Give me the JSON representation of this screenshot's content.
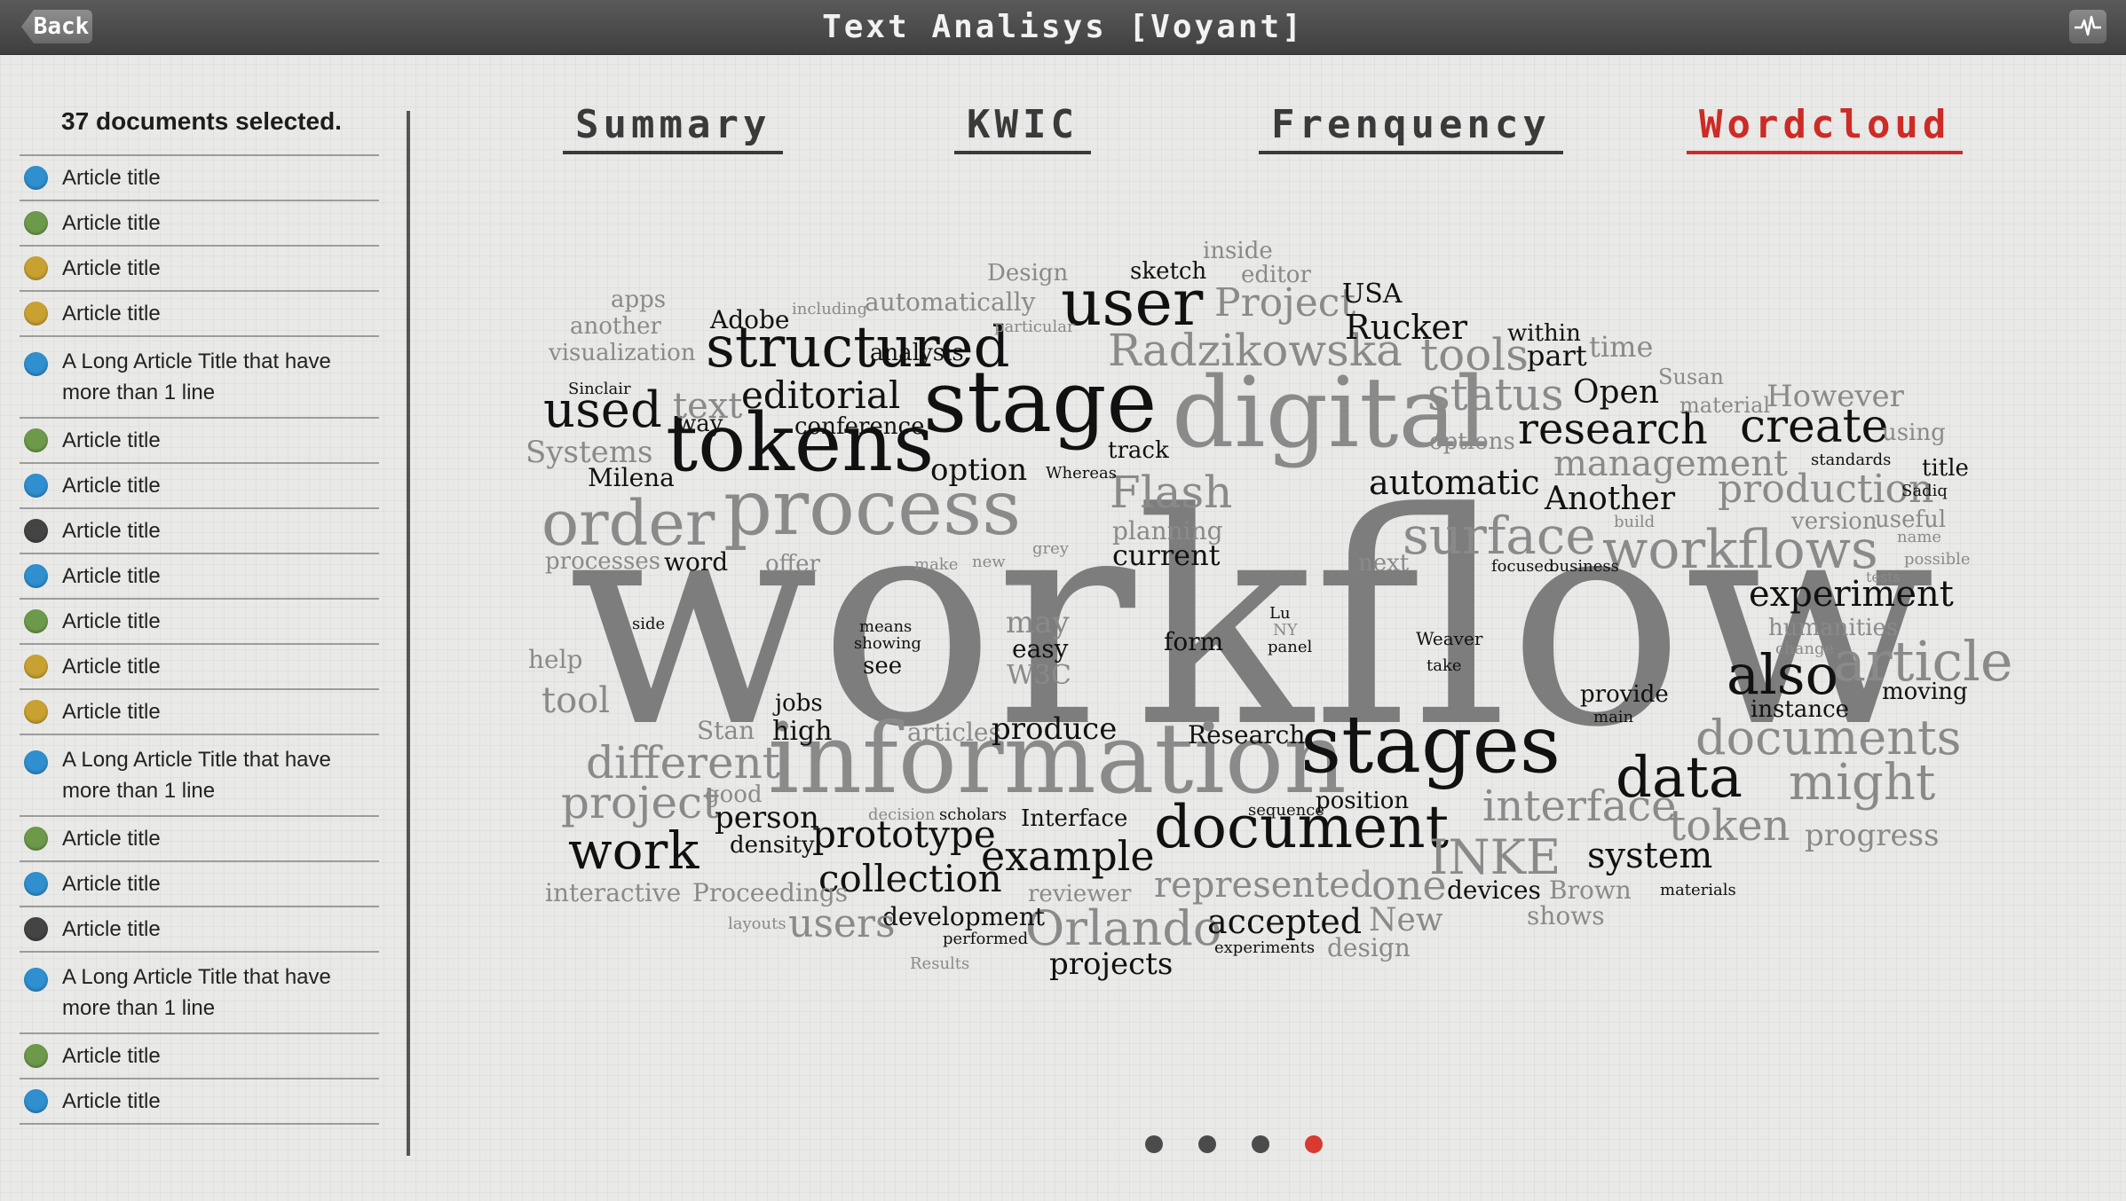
{
  "header": {
    "back_label": "Back",
    "title": "Text Analisys [Voyant]",
    "activity_icon": "pulse-icon"
  },
  "sidebar": {
    "selection_count": "37 documents selected.",
    "documents": [
      {
        "title": "Article title",
        "color": "#2f8fcf"
      },
      {
        "title": "Article title",
        "color": "#6c9a4a"
      },
      {
        "title": "Article title",
        "color": "#c9a131"
      },
      {
        "title": "Article title",
        "color": "#c9a131"
      },
      {
        "title": "A Long Article Title that have\nmore than 1 line",
        "color": "#2f8fcf"
      },
      {
        "title": "Article title",
        "color": "#6c9a4a"
      },
      {
        "title": "Article title",
        "color": "#2f8fcf"
      },
      {
        "title": "Article title",
        "color": "#444444"
      },
      {
        "title": "Article title",
        "color": "#2f8fcf"
      },
      {
        "title": "Article title",
        "color": "#6c9a4a"
      },
      {
        "title": "Article title",
        "color": "#c9a131"
      },
      {
        "title": "Article title",
        "color": "#c9a131"
      },
      {
        "title": "A Long Article Title that have\nmore than 1 line",
        "color": "#2f8fcf"
      },
      {
        "title": "Article title",
        "color": "#6c9a4a"
      },
      {
        "title": "Article title",
        "color": "#2f8fcf"
      },
      {
        "title": "Article title",
        "color": "#444444"
      },
      {
        "title": "A Long Article Title that have\nmore than 1 line",
        "color": "#2f8fcf"
      },
      {
        "title": "Article title",
        "color": "#6c9a4a"
      },
      {
        "title": "Article title",
        "color": "#2f8fcf"
      }
    ]
  },
  "tabs": [
    {
      "label": "Summary",
      "active": false
    },
    {
      "label": "KWIC",
      "active": false
    },
    {
      "label": "Frenquency",
      "active": false
    },
    {
      "label": "Wordcloud",
      "active": true
    }
  ],
  "wordcloud": [
    "workflow",
    "information",
    "stages",
    "tokens",
    "stage",
    "digital",
    "process",
    "order",
    "document",
    "structured",
    "user",
    "work",
    "data",
    "also",
    "article",
    "documents",
    "might",
    "interface",
    "token",
    "INKE",
    "one",
    "surface",
    "workflows",
    "research",
    "create",
    "management",
    "production",
    "Orlando",
    "example",
    "prototype",
    "different",
    "project",
    "collection",
    "experiment",
    "represented",
    "accepted",
    "projects",
    "Radzikowska",
    "status",
    "tools",
    "Project",
    "Rucker",
    "editorial",
    "used",
    "text",
    "automatic",
    "option",
    "current",
    "Flash",
    "planning",
    "Another",
    "Open",
    "However",
    "material",
    "Susan",
    "time",
    "part",
    "within",
    "USA",
    "inside",
    "editor",
    "sketch",
    "Design",
    "automatically",
    "analysis",
    "particular",
    "including",
    "Adobe",
    "apps",
    "another",
    "visualization",
    "Sinclair",
    "way",
    "conference",
    "Systems",
    "Milena",
    "track",
    "Whereas",
    "options",
    "using",
    "title",
    "standards",
    "Sadiq",
    "version",
    "useful",
    "build",
    "name",
    "possible",
    "tests",
    "humanities",
    "change",
    "instance",
    "moving",
    "provide",
    "main",
    "system",
    "position",
    "sequence",
    "decision",
    "scholars",
    "Interface",
    "person",
    "density",
    "good",
    "Stan",
    "high",
    "articles",
    "produce",
    "Research",
    "jobs",
    "tool",
    "help",
    "side",
    "means",
    "showing",
    "see",
    "may",
    "easy",
    "W3C",
    "form",
    "Lu",
    "NY",
    "panel",
    "Weaver",
    "take",
    "processes",
    "word",
    "offer",
    "make",
    "new",
    "grey",
    "next",
    "focused",
    "business",
    "progress",
    "devices",
    "Brown",
    "shows",
    "materials",
    "New",
    "design",
    "experiments",
    "performed",
    "Results",
    "development",
    "users",
    "layouts",
    "Proceedings",
    "interactive",
    "reviewer"
  ],
  "pager": {
    "pages": 4,
    "current": 4
  }
}
